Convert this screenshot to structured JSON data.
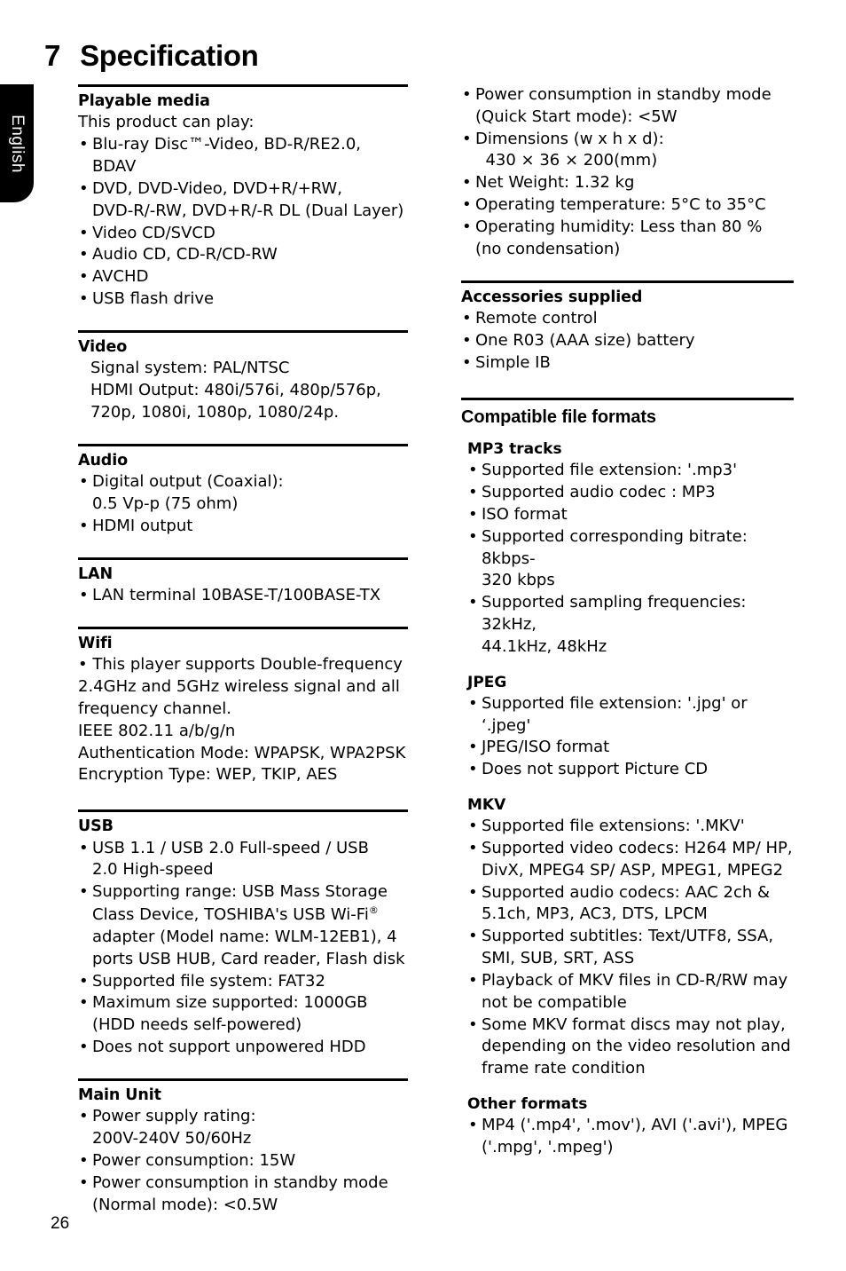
{
  "language_tab": {
    "label": "English"
  },
  "chapter": {
    "number": "7",
    "title": "Specification"
  },
  "page": {
    "number": "26"
  },
  "left_column": {
    "sections": [
      {
        "title": "Playable media",
        "intro": "This product can play:",
        "bullets": [
          "Blu-ray Disc™-Video, BD-R/RE2.0, BDAV",
          "DVD, DVD-Video, DVD+R/+RW,\nDVD-R/-RW, DVD+R/-R DL (Dual Layer)",
          "Video CD/SVCD",
          "Audio CD, CD-R/CD-RW",
          "AVCHD",
          "USB flash drive"
        ]
      },
      {
        "title": "Video",
        "lines": [
          "Signal system: PAL/NTSC",
          "HDMI Output: 480i/576i, 480p/576p,\n720p, 1080i, 1080p, 1080/24p."
        ]
      },
      {
        "title": "Audio",
        "bullets": [
          "Digital output (Coaxial):\n0.5 Vp-p (75 ohm)",
          "HDMI output"
        ]
      },
      {
        "title": "LAN",
        "bullets": [
          "LAN terminal 10BASE-T/100BASE-TX"
        ]
      },
      {
        "title": "Wifi",
        "bullets": [
          "• This player supports Double-frequency\n2.4GHz and 5GHz wireless signal and all\nfrequency channel.\nIEEE 802.11 a/b/g/n\nAuthentication Mode: WPAPSK, WPA2PSK\nEncryption Type: WEP, TKIP, AES"
        ]
      },
      {
        "title": "USB",
        "bullets": [
          "USB 1.1 / USB 2.0 Full-speed / USB\n2.0 High-speed",
          "Supporting range: USB Mass Storage\nClass Device, TOSHIBA's USB Wi-Fi®\nadapter (Model name: WLM-12EB1), 4\nports USB HUB, Card reader, Flash disk",
          "Supported file system: FAT32",
          "Maximum size supported: 1000GB\n(HDD needs self-powered)",
          "Does not support unpowered HDD"
        ]
      },
      {
        "title": "Main Unit",
        "bullets": [
          "Power supply rating:\n200V-240V 50/60Hz",
          "Power consumption: 15W",
          "Power consumption in standby mode\n(Normal mode): <0.5W"
        ]
      }
    ]
  },
  "right_column": {
    "continued_bullets": [
      "Power consumption in standby mode\n(Quick Start mode): <5W",
      "Dimensions (w x h x d):\n  430 × 36 × 200(mm)",
      "Net Weight: 1.32 kg",
      "Operating temperature: 5°C to 35°C",
      "Operating humidity: Less than 80 %\n(no condensation)"
    ],
    "sections": [
      {
        "title": "Accessories supplied",
        "bullets": [
          "Remote control",
          "One R03 (AAA size) battery",
          "Simple IB"
        ]
      },
      {
        "title": "Compatible file formats",
        "subsections": [
          {
            "title": "MP3 tracks",
            "bullets": [
              "Supported file extension: '.mp3'",
              "Supported audio codec : MP3",
              "ISO format",
              "Supported corresponding bitrate: 8kbps-\n320 kbps",
              "Supported sampling frequencies: 32kHz,\n44.1kHz, 48kHz"
            ]
          },
          {
            "title": "JPEG",
            "bullets": [
              "Supported file extension: '.jpg' or ‘.jpeg'",
              "JPEG/ISO format",
              "Does not support Picture CD"
            ]
          },
          {
            "title": "MKV",
            "bullets": [
              "Supported file extensions: '.MKV'",
              "Supported video codecs: H264 MP/ HP,\nDivX, MPEG4 SP/ ASP, MPEG1, MPEG2",
              "Supported audio codecs: AAC 2ch &\n5.1ch, MP3, AC3, DTS, LPCM",
              "Supported subtitles: Text/UTF8, SSA,\nSMI, SUB, SRT, ASS",
              "Playback of MKV files in CD-R/RW may\nnot be compatible",
              "Some MKV format discs may not play,\ndepending on the video resolution and\nframe rate condition"
            ]
          },
          {
            "title": "Other formats",
            "bullets": [
              "MP4 ('.mp4', '.mov'), AVI ('.avi'), MPEG\n('.mpg', '.mpeg')"
            ]
          }
        ]
      }
    ]
  }
}
